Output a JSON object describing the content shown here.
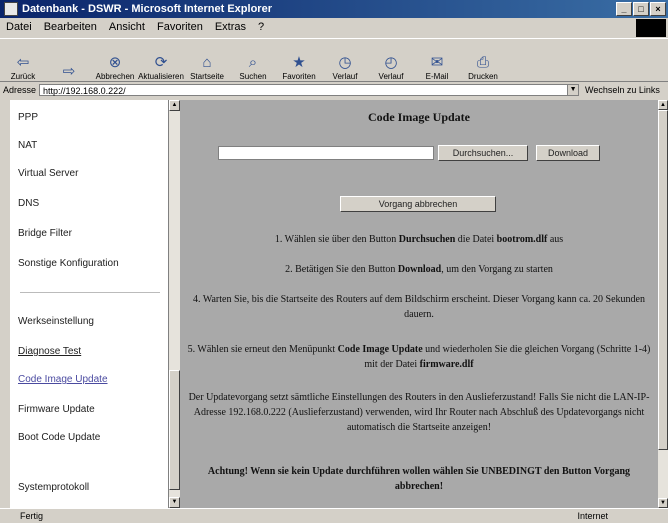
{
  "window": {
    "title": "Datenbank - DSWR - Microsoft Internet Explorer"
  },
  "menu": {
    "items": [
      "Datei",
      "Bearbeiten",
      "Ansicht",
      "Favoriten",
      "Extras",
      "?"
    ]
  },
  "toolbar": {
    "buttons": [
      {
        "label": "Zurück",
        "icon": "back-arrow-icon"
      },
      {
        "label": "",
        "icon": "forward-arrow-icon"
      },
      {
        "label": "Abbrechen",
        "icon": "stop-icon"
      },
      {
        "label": "Aktualisieren",
        "icon": "refresh-icon"
      },
      {
        "label": "Startseite",
        "icon": "home-icon"
      },
      {
        "label": "Suchen",
        "icon": "search-icon"
      },
      {
        "label": "Favoriten",
        "icon": "favorites-icon"
      },
      {
        "label": "Verlauf",
        "icon": "history-icon"
      },
      {
        "label": "Verlauf",
        "icon": "history-icon"
      },
      {
        "label": "E-Mail",
        "icon": "mail-icon"
      },
      {
        "label": "Drucken",
        "icon": "print-icon"
      }
    ]
  },
  "address": {
    "label": "Adresse",
    "url": "http://192.168.0.222/",
    "go_label": "Wechseln zu  Links"
  },
  "nav": {
    "items": [
      {
        "label": "PPP",
        "style": "plain"
      },
      {
        "label": "NAT",
        "style": "plain"
      },
      {
        "label": "Virtual Server",
        "style": "plain"
      },
      {
        "label": "DNS",
        "style": "plain"
      },
      {
        "label": "Bridge Filter",
        "style": "plain"
      },
      {
        "label": "Sonstige Konfiguration",
        "style": "plain"
      },
      {
        "label": "Werkseinstellung",
        "style": "plain"
      },
      {
        "label": "Diagnose Test",
        "style": "link"
      },
      {
        "label": "Code Image Update",
        "style": "active"
      },
      {
        "label": "Firmware Update",
        "style": "plain"
      },
      {
        "label": "Boot Code Update",
        "style": "plain"
      },
      {
        "label": "Systemprotokoll",
        "style": "plain"
      }
    ]
  },
  "main": {
    "title": "Code Image Update",
    "file_value": "",
    "browse_label": "Durchsuchen...",
    "download_label": "Download",
    "cancel_label": "Vorgang abbrechen",
    "step1_pre": "1. Wählen sie über den Button ",
    "step1_b1": "Durchsuchen",
    "step1_mid": " die Datei ",
    "step1_b2": "bootrom.dlf",
    "step1_post": " aus",
    "step2_pre": "2. Betätigen Sie den Button ",
    "step2_b": "Download",
    "step2_post": ", um den Vorgang zu starten",
    "step4": "4. Warten Sie, bis die Startseite des Routers auf dem Bildschirm erscheint. Dieser Vorgang kann ca. 20 Sekunden dauern.",
    "step5_pre": "5. Wählen sie erneut den Menüpunkt ",
    "step5_b1": "Code Image Update",
    "step5_mid": " und wiederholen Sie die gleichen Vorgang (Schritte 1-4) mit der Datei ",
    "step5_b2": "firmware.dlf",
    "note": "Der Updatevorgang setzt sämtliche Einstellungen des Routers in den Auslieferzustand! Falls Sie nicht die LAN-IP-Adresse 192.168.0.222 (Auslieferzustand) verwenden, wird Ihr Router nach Abschluß des Updatevorgangs nicht automatisch die Startseite anzeigen!",
    "warning": "Achtung! Wenn sie kein Update durchführen wollen wählen Sie UNBEDINGT den Button Vorgang abbrechen!"
  },
  "status": {
    "left": "Fertig",
    "right": "Internet"
  }
}
